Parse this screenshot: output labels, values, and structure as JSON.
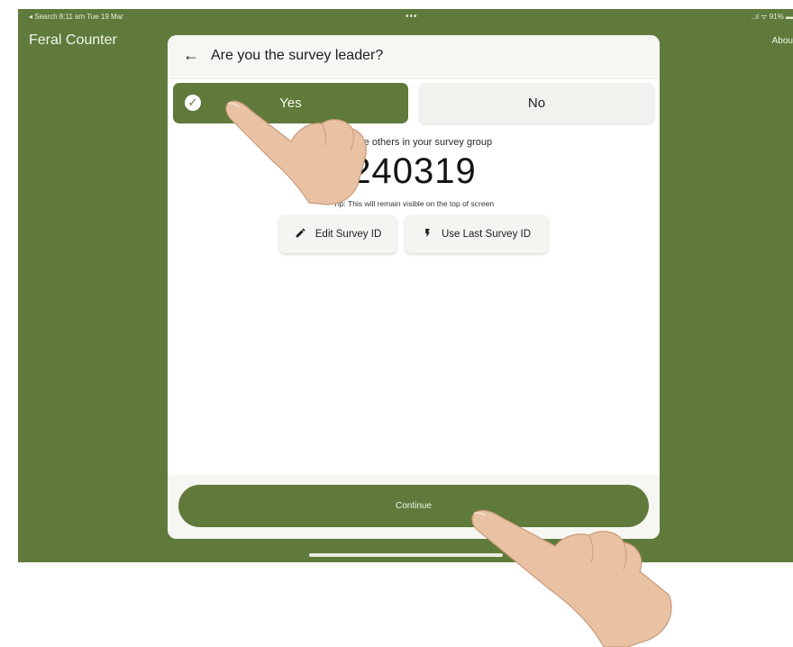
{
  "statusbar": {
    "left": "◂ Search  8:11 am  Tue 19 Mar",
    "center": "•••",
    "right": "..ıl ᯤ 91% ▬"
  },
  "app": {
    "title": "Feral Counter",
    "about": "Abou"
  },
  "dialog": {
    "back_icon": "arrow-left-icon",
    "title": "Are you the survey leader?",
    "options": {
      "yes": "Yes",
      "no": "No",
      "selected": "yes"
    },
    "share_text": "with the others in your survey group",
    "survey_id": "240319",
    "tip": "Tip: This will remain visible on the top of screen",
    "edit_button": "Edit Survey ID",
    "last_button": "Use Last Survey ID",
    "continue_button": "Continue"
  },
  "colors": {
    "brand_green": "#5f7a3b",
    "surface": "#f6f6f2"
  }
}
